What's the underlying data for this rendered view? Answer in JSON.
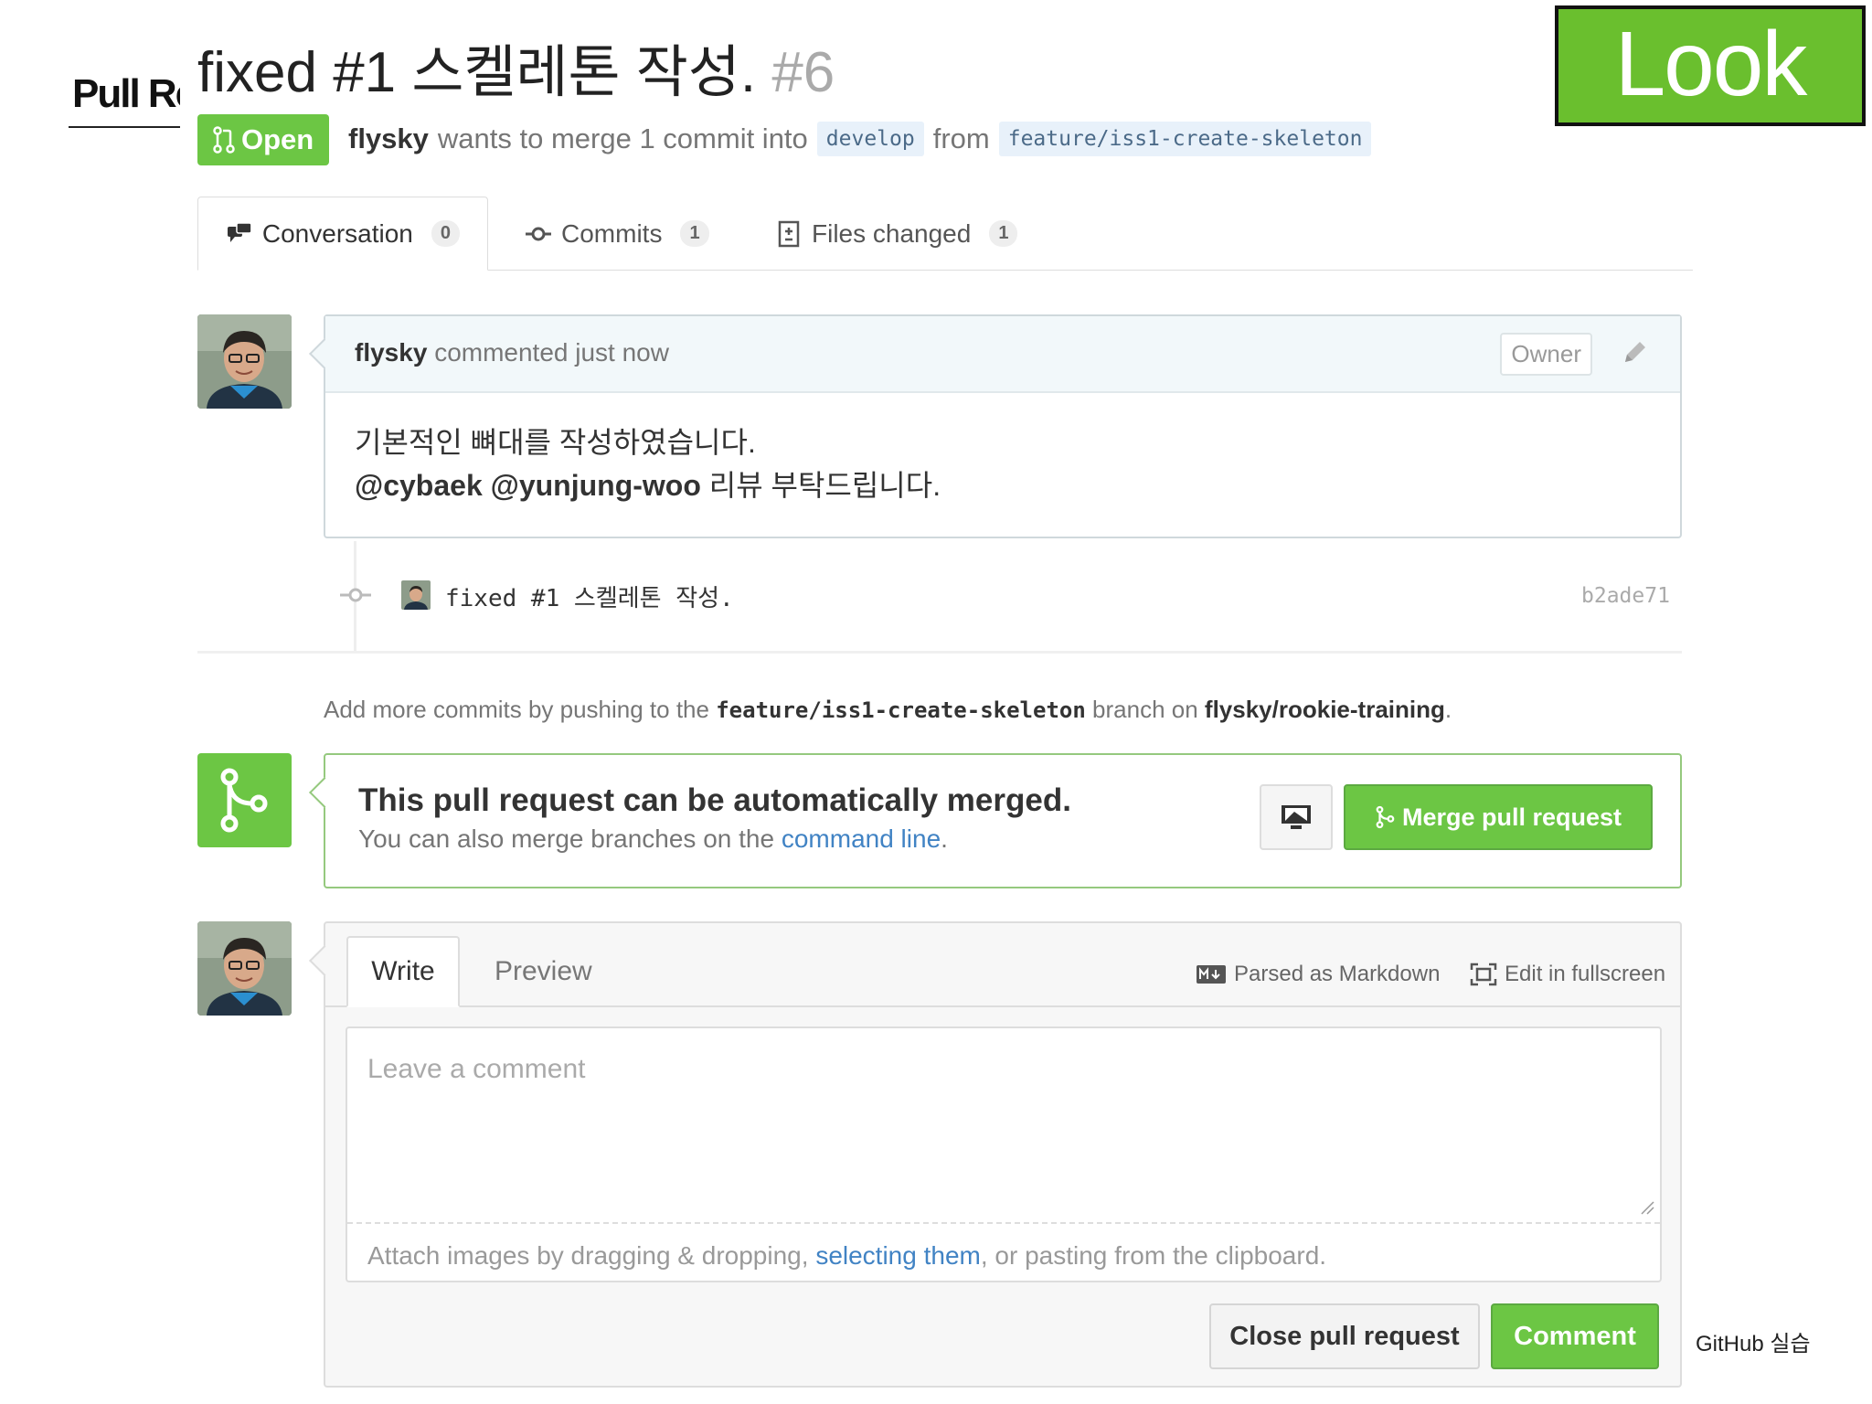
{
  "slide": {
    "title": "Pull Re",
    "look_badge": "Look",
    "footer": "GitHub 실습"
  },
  "pr": {
    "title": "fixed #1 스켈레톤 작성.",
    "number": "#6",
    "state": "Open",
    "author": "flysky",
    "merge_text": "wants to merge 1 commit into",
    "base_branch": "develop",
    "from_text": "from",
    "head_branch": "feature/iss1-create-skeleton"
  },
  "tabs": [
    {
      "label": "Conversation",
      "count": "0"
    },
    {
      "label": "Commits",
      "count": "1"
    },
    {
      "label": "Files changed",
      "count": "1"
    }
  ],
  "comment": {
    "author": "flysky",
    "meta": "commented just now",
    "role_badge": "Owner",
    "body_line1": "기본적인 뼈대를 작성하였습니다.",
    "mentions": "@cybaek @yunjung-woo",
    "body_line2_rest": "리뷰 부탁드립니다."
  },
  "commit": {
    "message": "fixed #1 스켈레톤 작성.",
    "sha": "b2ade71"
  },
  "push_hint": {
    "prefix": "Add more commits by pushing to the",
    "branch": "feature/iss1-create-skeleton",
    "middle": "branch on",
    "repo": "flysky/rookie-training",
    "suffix": "."
  },
  "merge": {
    "heading": "This pull request can be automatically merged.",
    "sub_prefix": "You can also merge branches on the",
    "sub_link": "command line",
    "sub_suffix": ".",
    "button_label": "Merge pull request"
  },
  "form": {
    "write_tab": "Write",
    "preview_tab": "Preview",
    "markdown_note": "Parsed as Markdown",
    "fullscreen_note": "Edit in fullscreen",
    "placeholder": "Leave a comment",
    "attach_prefix": "Attach images by dragging & dropping,",
    "attach_link": "selecting them",
    "attach_suffix": ", or pasting from the clipboard.",
    "close_button": "Close pull request",
    "comment_button": "Comment"
  },
  "colors": {
    "accent_green": "#6cc644",
    "link_blue": "#4183c4",
    "look_green": "#6abf2e"
  }
}
